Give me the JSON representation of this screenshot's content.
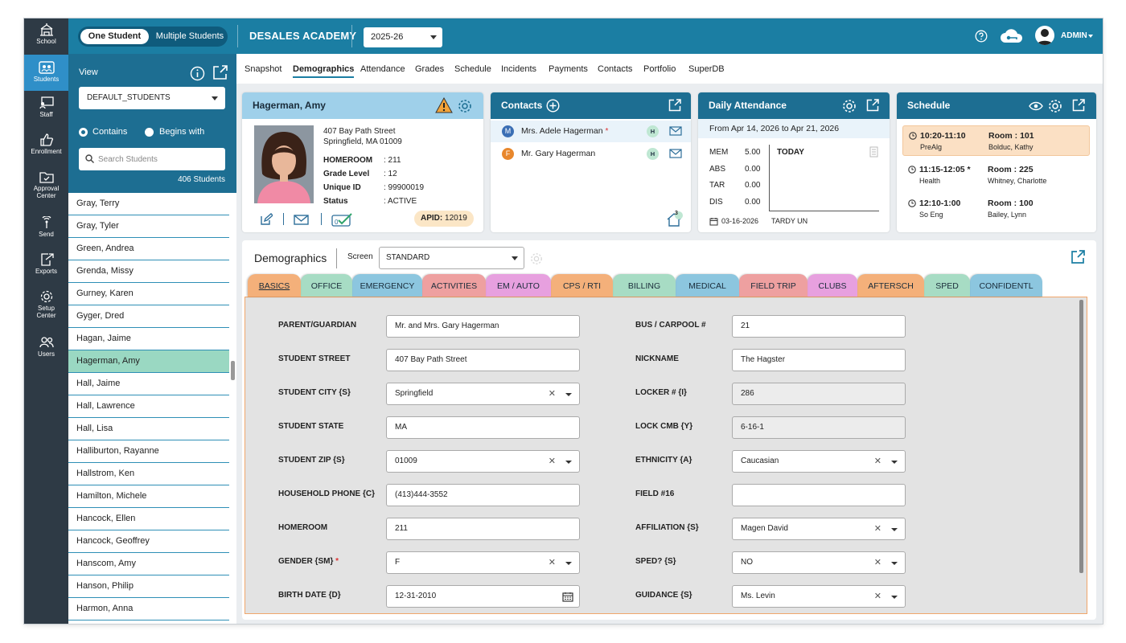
{
  "leftnav": [
    {
      "label": "School",
      "icon": "school-icon"
    },
    {
      "label": "Students",
      "icon": "students-icon",
      "active": true
    },
    {
      "label": "Staff",
      "icon": "staff-icon"
    },
    {
      "label": "Enrollment",
      "icon": "enrollment-icon"
    },
    {
      "label": "Approval Center",
      "icon": "approval-icon"
    },
    {
      "label": "Send",
      "icon": "send-icon"
    },
    {
      "label": "Exports",
      "icon": "exports-icon"
    },
    {
      "label": "Setup Center",
      "icon": "setup-icon"
    },
    {
      "label": "Users",
      "icon": "users-icon"
    }
  ],
  "topbar": {
    "one_student": "One Student",
    "multiple_students": "Multiple Students",
    "school_name": "DESALES ACADEMY",
    "year": "2025-26",
    "user": "ADMIN",
    "brand_color": "#1b7ea3"
  },
  "student_panel": {
    "view_label": "View",
    "view_value": "DEFAULT_STUDENTS",
    "contains": "Contains",
    "begins_with": "Begins with",
    "search_placeholder": "Search Students",
    "count": "406 Students",
    "students": [
      "Gray, Terry",
      "Gray, Tyler",
      "Green, Andrea",
      "Grenda, Missy",
      "Gurney, Karen",
      "Gyger, Dred",
      "Hagan, Jaime",
      "Hagerman, Amy",
      "Hall, Jaime",
      "Hall, Lawrence",
      "Hall, Lisa",
      "Halliburton, Rayanne",
      "Hallstrom, Ken",
      "Hamilton, Michele",
      "Hancock, Ellen",
      "Hancock, Geoffrey",
      "Hanscom, Amy",
      "Hanson, Philip",
      "Harmon, Anna"
    ],
    "selected": "Hagerman, Amy"
  },
  "nav_tabs": [
    "Snapshot",
    "Demographics",
    "Attendance",
    "Grades",
    "Schedule",
    "Incidents",
    "Payments",
    "Contacts",
    "Portfolio",
    "SuperDB"
  ],
  "active_tab": "Demographics",
  "student_card": {
    "name": "Hagerman, Amy",
    "street": "407 Bay Path Street",
    "city_line": "Springfield, MA 01009",
    "fields": [
      {
        "k": "HOMEROOM",
        "v": ": 211"
      },
      {
        "k": "Grade Level",
        "v": ": 12"
      },
      {
        "k": "Unique ID",
        "v": ": 99900019"
      },
      {
        "k": "Status",
        "v": ": ACTIVE"
      }
    ],
    "apid_label": "APID:",
    "apid": "12019"
  },
  "contacts": {
    "title": "Contacts",
    "items": [
      {
        "initial": "M",
        "name": "Mrs. Adele Hagerman",
        "required": "*",
        "badge": "H",
        "color": "#3b6fb4"
      },
      {
        "initial": "F",
        "name": "Mr. Gary Hagerman",
        "required": "",
        "badge": "H",
        "color": "#e8872c"
      }
    ],
    "home_count": "3"
  },
  "attendance": {
    "title": "Daily Attendance",
    "range": "From Apr 14, 2026 to Apr 21, 2026",
    "rows": [
      {
        "k": "MEM",
        "v": "5.00"
      },
      {
        "k": "ABS",
        "v": "0.00"
      },
      {
        "k": "TAR",
        "v": "0.00"
      },
      {
        "k": "DIS",
        "v": "0.00"
      }
    ],
    "today": "TODAY",
    "last_date": "03-16-2026",
    "last_code": "TARDY UN"
  },
  "schedule": {
    "title": "Schedule",
    "items": [
      {
        "time": "10:20-11:10",
        "course": "PreAlg",
        "room": "Room : 101",
        "teacher": "Bolduc, Kathy",
        "current": true
      },
      {
        "time": "11:15-12:05 *",
        "course": "Health",
        "room": "Room : 225",
        "teacher": "Whitney, Charlotte",
        "current": false
      },
      {
        "time": "12:10-1:00",
        "course": "So Eng",
        "room": "Room : 100",
        "teacher": "Bailey, Lynn",
        "current": false
      }
    ]
  },
  "demographics": {
    "title": "Demographics",
    "screen_label": "Screen",
    "screen_value": "STANDARD",
    "tabs": [
      {
        "label": "BASICS",
        "color": "#f4b07a"
      },
      {
        "label": "OFFICE",
        "color": "#a7dcc4"
      },
      {
        "label": "EMERGENCY",
        "color": "#8cc6df"
      },
      {
        "label": "ACTIVITIES",
        "color": "#eea0a0"
      },
      {
        "label": "EM / AUTO",
        "color": "#e7a0df"
      },
      {
        "label": "CPS / RTI",
        "color": "#f4b07a"
      },
      {
        "label": "BILLING",
        "color": "#a7dcc4"
      },
      {
        "label": "MEDICAL",
        "color": "#8cc6df"
      },
      {
        "label": "FIELD TRIP",
        "color": "#eea0a0"
      },
      {
        "label": "CLUBS",
        "color": "#e7a0df"
      },
      {
        "label": "AFTERSCH",
        "color": "#f4b07a"
      },
      {
        "label": "SPED",
        "color": "#a7dcc4"
      },
      {
        "label": "CONFIDENTL",
        "color": "#8cc6df"
      }
    ],
    "left_fields": [
      {
        "label": "PARENT/GUARDIAN",
        "value": "Mr. and Mrs. Gary Hagerman",
        "type": "text"
      },
      {
        "label": "STUDENT STREET",
        "value": "407 Bay Path Street",
        "type": "text"
      },
      {
        "label": "STUDENT CITY {S}",
        "value": "Springfield",
        "type": "select"
      },
      {
        "label": "STUDENT STATE",
        "value": "MA",
        "type": "text"
      },
      {
        "label": "STUDENT ZIP {S}",
        "value": "01009",
        "type": "select"
      },
      {
        "label": "HOUSEHOLD PHONE {C}",
        "value": "(413)444-3552",
        "type": "text"
      },
      {
        "label": "HOMEROOM",
        "value": "211",
        "type": "text"
      },
      {
        "label": "GENDER {SM}",
        "required": "*",
        "value": "F",
        "type": "select"
      },
      {
        "label": "BIRTH DATE {D}",
        "value": "12-31-2010",
        "type": "date"
      }
    ],
    "right_fields": [
      {
        "label": "BUS / CARPOOL #",
        "value": "21",
        "type": "text"
      },
      {
        "label": "NICKNAME",
        "value": "The Hagster",
        "type": "text"
      },
      {
        "label": "LOCKER # {I}",
        "value": "286",
        "type": "readonly"
      },
      {
        "label": "LOCK CMB {Y}",
        "value": "6-16-1",
        "type": "readonly"
      },
      {
        "label": "ETHNICITY {A}",
        "value": "Caucasian",
        "type": "select"
      },
      {
        "label": "FIELD #16",
        "value": "",
        "type": "text"
      },
      {
        "label": "AFFILIATION {S}",
        "value": "Magen David",
        "type": "select"
      },
      {
        "label": "SPED? {S}",
        "value": "NO",
        "type": "select"
      },
      {
        "label": "GUIDANCE {S}",
        "value": "Ms. Levin",
        "type": "select"
      }
    ]
  }
}
